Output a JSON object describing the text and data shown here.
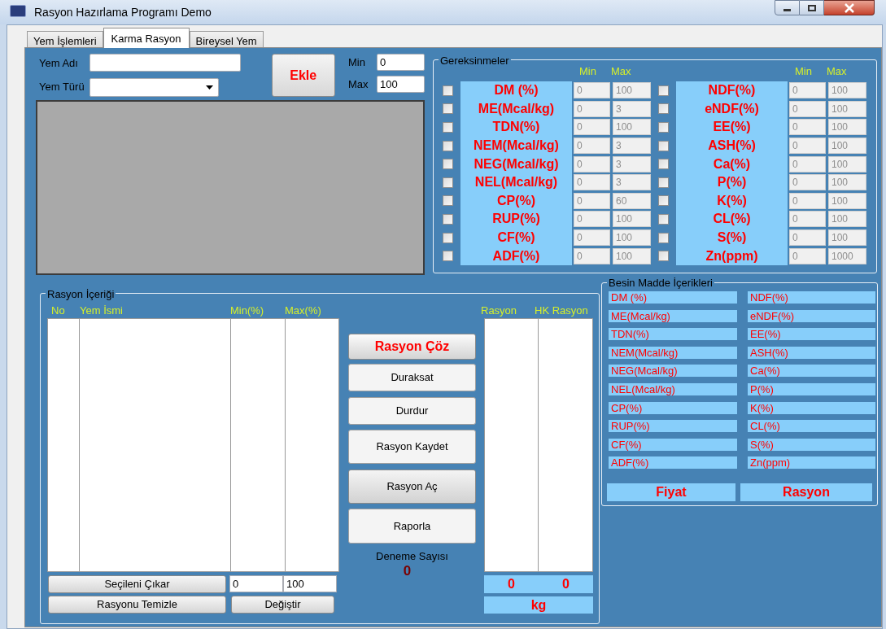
{
  "window": {
    "title": "Rasyon Hazırlama Programı Demo"
  },
  "tabs": [
    {
      "label": "Yem İşlemleri",
      "selected": false
    },
    {
      "label": "Karma Rasyon",
      "selected": true
    },
    {
      "label": "Bireysel Yem",
      "selected": false
    }
  ],
  "feed_form": {
    "name_label": "Yem Adı",
    "type_label": "Yem Türü",
    "add_button": "Ekle",
    "min_label": "Min",
    "min_value": "0",
    "max_label": "Max",
    "max_value": "100"
  },
  "requirements": {
    "title": "Gereksinmeler",
    "headers": [
      {
        "min": "Min",
        "max": "Max"
      },
      {
        "min": "Min",
        "max": "Max"
      }
    ],
    "items": [
      {
        "label": "DM (%)",
        "checked": false,
        "disabled": true,
        "min": "0",
        "max": "100"
      },
      {
        "label": "ME(Mcal/kg)",
        "checked": false,
        "disabled": true,
        "min": "0",
        "max": "3"
      },
      {
        "label": "TDN(%)",
        "checked": false,
        "disabled": true,
        "min": "0",
        "max": "100"
      },
      {
        "label": "NEM(Mcal/kg)",
        "checked": false,
        "disabled": true,
        "min": "0",
        "max": "3"
      },
      {
        "label": "NEG(Mcal/kg)",
        "checked": false,
        "disabled": true,
        "min": "0",
        "max": "3"
      },
      {
        "label": "NEL(Mcal/kg)",
        "checked": false,
        "disabled": true,
        "min": "0",
        "max": "3"
      },
      {
        "label": "CP(%)",
        "checked": false,
        "disabled": true,
        "min": "0",
        "max": "60"
      },
      {
        "label": "RUP(%)",
        "checked": false,
        "disabled": true,
        "min": "0",
        "max": "100"
      },
      {
        "label": "CF(%)",
        "checked": false,
        "disabled": true,
        "min": "0",
        "max": "100"
      },
      {
        "label": "ADF(%)",
        "checked": false,
        "disabled": true,
        "min": "0",
        "max": "100"
      },
      {
        "label": "NDF(%)",
        "checked": false,
        "disabled": true,
        "min": "0",
        "max": "100"
      },
      {
        "label": "eNDF(%)",
        "checked": false,
        "disabled": true,
        "min": "0",
        "max": "100"
      },
      {
        "label": "EE(%)",
        "checked": false,
        "disabled": true,
        "min": "0",
        "max": "100"
      },
      {
        "label": "ASH(%)",
        "checked": false,
        "disabled": true,
        "min": "0",
        "max": "100"
      },
      {
        "label": "Ca(%)",
        "checked": false,
        "disabled": true,
        "min": "0",
        "max": "100"
      },
      {
        "label": "P(%)",
        "checked": false,
        "disabled": true,
        "min": "0",
        "max": "100"
      },
      {
        "label": "K(%)",
        "checked": false,
        "disabled": true,
        "min": "0",
        "max": "100"
      },
      {
        "label": "CL(%)",
        "checked": false,
        "disabled": true,
        "min": "0",
        "max": "100"
      },
      {
        "label": "S(%)",
        "checked": false,
        "disabled": true,
        "min": "0",
        "max": "100"
      },
      {
        "label": "Zn(ppm)",
        "checked": false,
        "disabled": true,
        "min": "0",
        "max": "1000"
      }
    ]
  },
  "ration_content": {
    "title": "Rasyon İçeriği",
    "columns": [
      "No",
      "Yem İsmi",
      "Min(%)",
      "Max(%)"
    ],
    "remove_button": "Seçileni Çıkar",
    "clear_button": "Rasyonu Temizle",
    "min_value": "0",
    "max_value": "100",
    "change_button": "Değiştir",
    "actions": [
      {
        "label": "Rasyon Çöz",
        "kind": "primary"
      },
      {
        "label": "Duraksat",
        "kind": "normal"
      },
      {
        "label": "Durdur",
        "kind": "normal"
      },
      {
        "label": "Rasyon Kaydet",
        "kind": "normal"
      },
      {
        "label": "Rasyon Aç",
        "kind": "default"
      },
      {
        "label": "Raporla",
        "kind": "normal"
      }
    ],
    "trials_label": "Deneme Sayısı",
    "trials_value": "0",
    "result_columns": [
      "Rasyon",
      "HK Rasyon"
    ],
    "totals": [
      "0",
      "0"
    ],
    "unit": "kg"
  },
  "nutrients": {
    "title": "Besin Madde İçerikleri",
    "items": [
      "DM (%)",
      "ME(Mcal/kg)",
      "TDN(%)",
      "NEM(Mcal/kg)",
      "NEG(Mcal/kg)",
      "NEL(Mcal/kg)",
      "CP(%)",
      "RUP(%)",
      "CF(%)",
      "ADF(%)",
      "NDF(%)",
      "eNDF(%)",
      "EE(%)",
      "ASH(%)",
      "Ca(%)",
      "P(%)",
      "K(%)",
      "CL(%)",
      "S(%)",
      "Zn(ppm)"
    ],
    "footer": [
      "Fiyat",
      "Rasyon"
    ]
  }
}
